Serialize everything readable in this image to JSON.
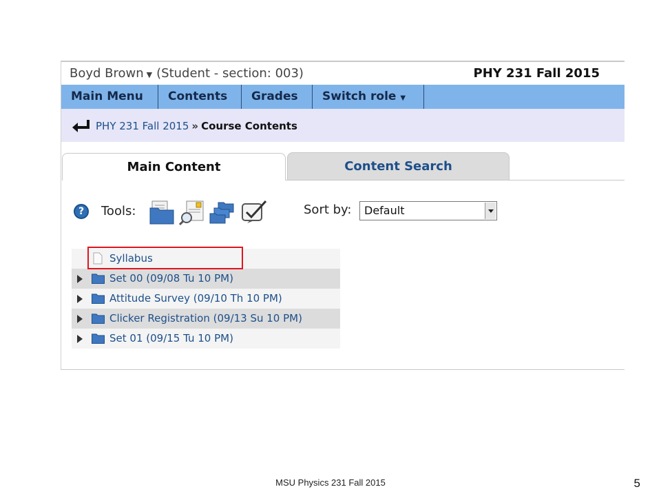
{
  "header": {
    "user_name": "Boyd Brown",
    "role": "(Student  - section: 003)",
    "course_title": "PHY 231 Fall 2015"
  },
  "menu": {
    "items": [
      {
        "label": "Main Menu"
      },
      {
        "label": "Contents"
      },
      {
        "label": "Grades"
      },
      {
        "label": "Switch role"
      }
    ]
  },
  "breadcrumb": {
    "parent": "PHY 231 Fall 2015",
    "separator": "»",
    "current": "Course Contents"
  },
  "tabs": {
    "main": "Main Content",
    "search": "Content Search"
  },
  "tools": {
    "label": "Tools:",
    "icons": [
      "folder-icon",
      "search-document-icon",
      "multiple-folders-icon",
      "checkbox-icon"
    ],
    "sort_label": "Sort by:",
    "sort_value": "Default"
  },
  "contents": [
    {
      "label": "Syllabus",
      "type": "document",
      "highlighted": true
    },
    {
      "label": "Set 00 (09/08 Tu 10 PM)",
      "type": "folder"
    },
    {
      "label": "Attitude Survey (09/10 Th 10 PM)",
      "type": "folder"
    },
    {
      "label": "Clicker Registration (09/13 Su 10 PM)",
      "type": "folder"
    },
    {
      "label": "Set 01 (09/15 Tu 10 PM)",
      "type": "folder"
    }
  ],
  "slide": {
    "footer": "MSU Physics 231 Fall 2015",
    "page_number": "5"
  },
  "colors": {
    "menu_bar": "#7fb4ea",
    "breadcrumb_bar": "#e6e6f8",
    "link": "#1d4f8a",
    "highlight_box": "#e0141e"
  }
}
